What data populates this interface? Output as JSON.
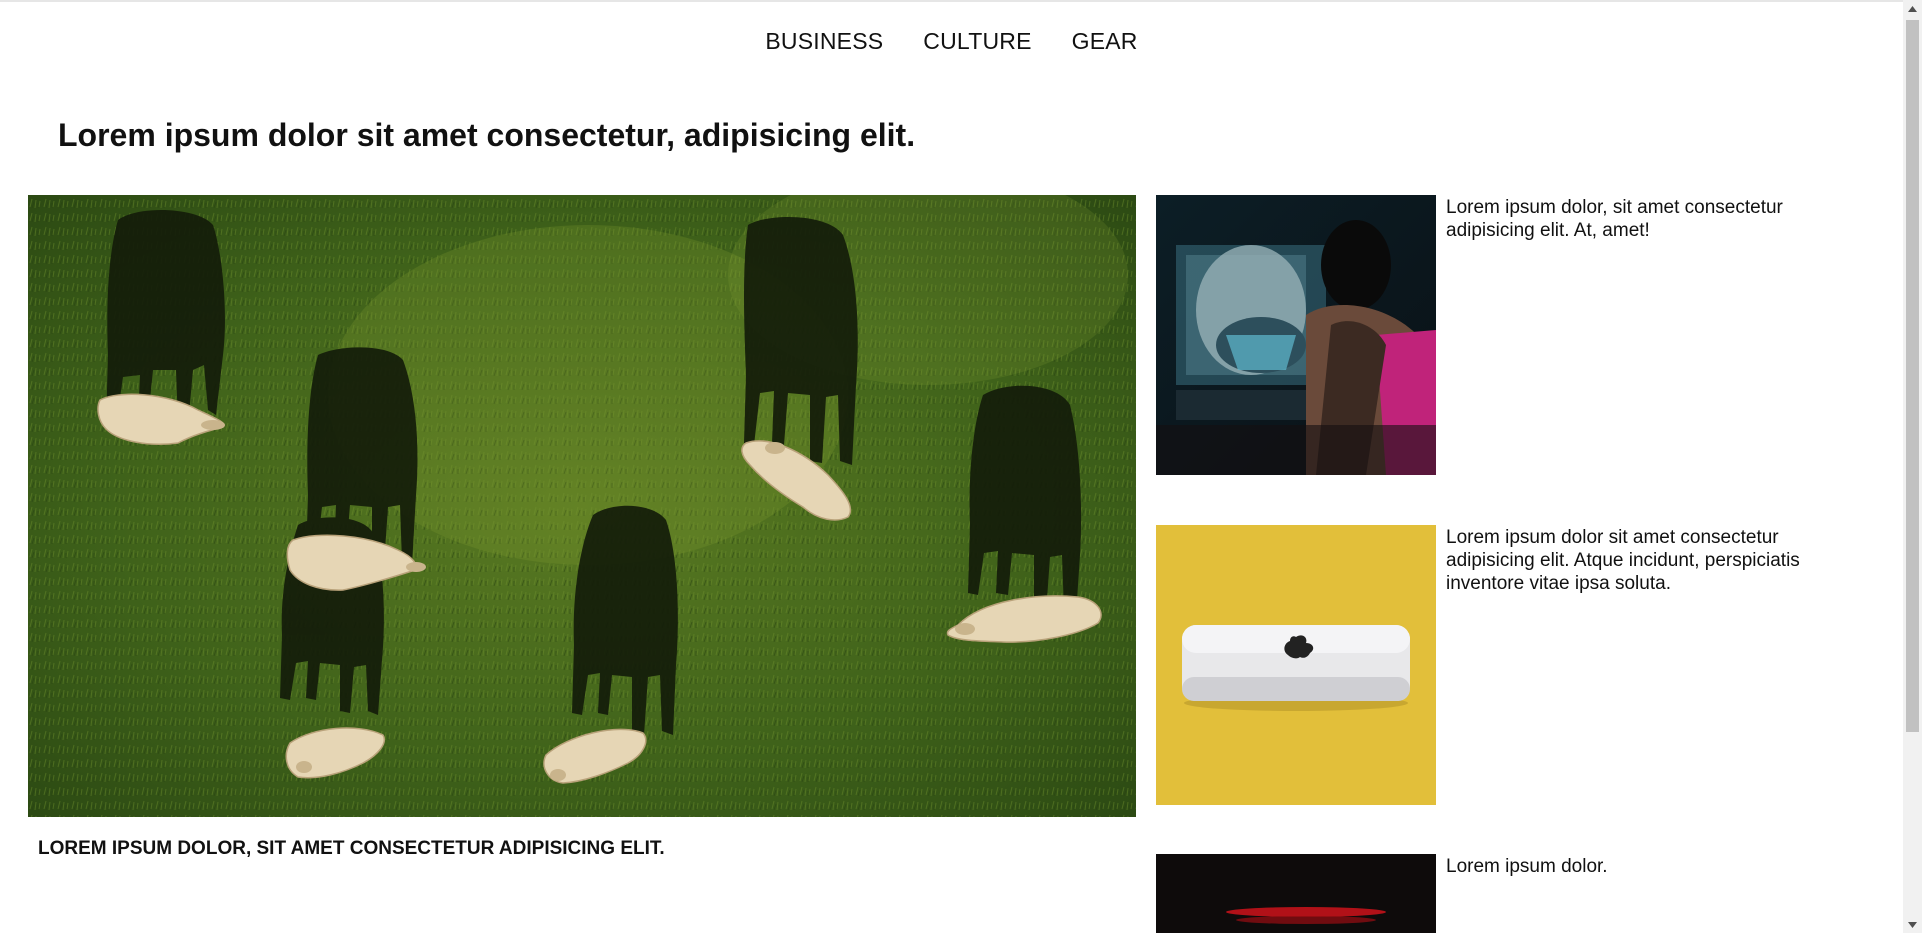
{
  "nav": {
    "items": [
      "BUSINESS",
      "CULTURE",
      "GEAR"
    ]
  },
  "headline": "Lorem ipsum dolor sit amet consectetur, adipisicing elit.",
  "hero": {
    "image": "aerial-cows-grazing-photo",
    "caption": "LOREM IPSUM DOLOR, SIT AMET CONSECTETUR ADIPISICING ELIT."
  },
  "side_articles": [
    {
      "image": "cyberpunk-character-photo",
      "text": "Lorem ipsum dolor, sit amet consectetur adipisicing elit. At, amet!"
    },
    {
      "image": "mac-mini-on-yellow-photo",
      "text": "Lorem ipsum dolor sit amet consectetur adipisicing elit. Atque incidunt, perspiciatis inventore vitae ipsa soluta."
    },
    {
      "image": "dark-red-light-photo",
      "text": "Lorem ipsum dolor."
    }
  ],
  "colors": {
    "grass": "#3c5d1a",
    "yellow": "#e2bf3a",
    "dark_bg": "#0f1a22",
    "magenta": "#c0237a"
  }
}
